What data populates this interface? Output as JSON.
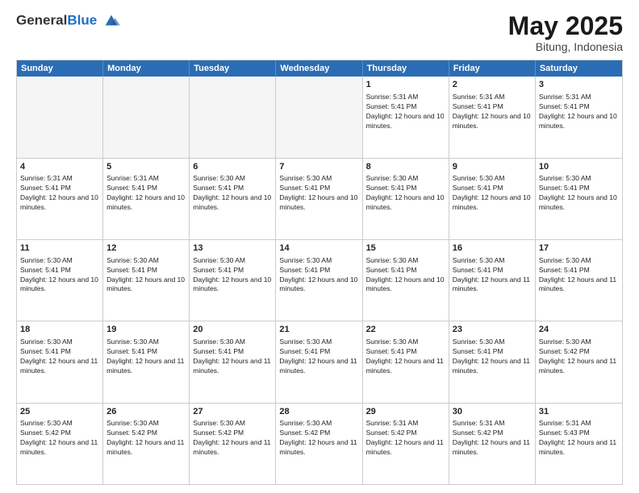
{
  "header": {
    "logo_general": "General",
    "logo_blue": "Blue",
    "title": "May 2025",
    "location": "Bitung, Indonesia"
  },
  "days_of_week": [
    "Sunday",
    "Monday",
    "Tuesday",
    "Wednesday",
    "Thursday",
    "Friday",
    "Saturday"
  ],
  "weeks": [
    [
      {
        "day": "",
        "empty": true
      },
      {
        "day": "",
        "empty": true
      },
      {
        "day": "",
        "empty": true
      },
      {
        "day": "",
        "empty": true
      },
      {
        "day": "1",
        "sunrise": "5:31 AM",
        "sunset": "5:41 PM",
        "daylight": "12 hours and 10 minutes."
      },
      {
        "day": "2",
        "sunrise": "5:31 AM",
        "sunset": "5:41 PM",
        "daylight": "12 hours and 10 minutes."
      },
      {
        "day": "3",
        "sunrise": "5:31 AM",
        "sunset": "5:41 PM",
        "daylight": "12 hours and 10 minutes."
      }
    ],
    [
      {
        "day": "4",
        "sunrise": "5:31 AM",
        "sunset": "5:41 PM",
        "daylight": "12 hours and 10 minutes."
      },
      {
        "day": "5",
        "sunrise": "5:31 AM",
        "sunset": "5:41 PM",
        "daylight": "12 hours and 10 minutes."
      },
      {
        "day": "6",
        "sunrise": "5:30 AM",
        "sunset": "5:41 PM",
        "daylight": "12 hours and 10 minutes."
      },
      {
        "day": "7",
        "sunrise": "5:30 AM",
        "sunset": "5:41 PM",
        "daylight": "12 hours and 10 minutes."
      },
      {
        "day": "8",
        "sunrise": "5:30 AM",
        "sunset": "5:41 PM",
        "daylight": "12 hours and 10 minutes."
      },
      {
        "day": "9",
        "sunrise": "5:30 AM",
        "sunset": "5:41 PM",
        "daylight": "12 hours and 10 minutes."
      },
      {
        "day": "10",
        "sunrise": "5:30 AM",
        "sunset": "5:41 PM",
        "daylight": "12 hours and 10 minutes."
      }
    ],
    [
      {
        "day": "11",
        "sunrise": "5:30 AM",
        "sunset": "5:41 PM",
        "daylight": "12 hours and 10 minutes."
      },
      {
        "day": "12",
        "sunrise": "5:30 AM",
        "sunset": "5:41 PM",
        "daylight": "12 hours and 10 minutes."
      },
      {
        "day": "13",
        "sunrise": "5:30 AM",
        "sunset": "5:41 PM",
        "daylight": "12 hours and 10 minutes."
      },
      {
        "day": "14",
        "sunrise": "5:30 AM",
        "sunset": "5:41 PM",
        "daylight": "12 hours and 10 minutes."
      },
      {
        "day": "15",
        "sunrise": "5:30 AM",
        "sunset": "5:41 PM",
        "daylight": "12 hours and 10 minutes."
      },
      {
        "day": "16",
        "sunrise": "5:30 AM",
        "sunset": "5:41 PM",
        "daylight": "12 hours and 11 minutes."
      },
      {
        "day": "17",
        "sunrise": "5:30 AM",
        "sunset": "5:41 PM",
        "daylight": "12 hours and 11 minutes."
      }
    ],
    [
      {
        "day": "18",
        "sunrise": "5:30 AM",
        "sunset": "5:41 PM",
        "daylight": "12 hours and 11 minutes."
      },
      {
        "day": "19",
        "sunrise": "5:30 AM",
        "sunset": "5:41 PM",
        "daylight": "12 hours and 11 minutes."
      },
      {
        "day": "20",
        "sunrise": "5:30 AM",
        "sunset": "5:41 PM",
        "daylight": "12 hours and 11 minutes."
      },
      {
        "day": "21",
        "sunrise": "5:30 AM",
        "sunset": "5:41 PM",
        "daylight": "12 hours and 11 minutes."
      },
      {
        "day": "22",
        "sunrise": "5:30 AM",
        "sunset": "5:41 PM",
        "daylight": "12 hours and 11 minutes."
      },
      {
        "day": "23",
        "sunrise": "5:30 AM",
        "sunset": "5:41 PM",
        "daylight": "12 hours and 11 minutes."
      },
      {
        "day": "24",
        "sunrise": "5:30 AM",
        "sunset": "5:42 PM",
        "daylight": "12 hours and 11 minutes."
      }
    ],
    [
      {
        "day": "25",
        "sunrise": "5:30 AM",
        "sunset": "5:42 PM",
        "daylight": "12 hours and 11 minutes."
      },
      {
        "day": "26",
        "sunrise": "5:30 AM",
        "sunset": "5:42 PM",
        "daylight": "12 hours and 11 minutes."
      },
      {
        "day": "27",
        "sunrise": "5:30 AM",
        "sunset": "5:42 PM",
        "daylight": "12 hours and 11 minutes."
      },
      {
        "day": "28",
        "sunrise": "5:30 AM",
        "sunset": "5:42 PM",
        "daylight": "12 hours and 11 minutes."
      },
      {
        "day": "29",
        "sunrise": "5:31 AM",
        "sunset": "5:42 PM",
        "daylight": "12 hours and 11 minutes."
      },
      {
        "day": "30",
        "sunrise": "5:31 AM",
        "sunset": "5:42 PM",
        "daylight": "12 hours and 11 minutes."
      },
      {
        "day": "31",
        "sunrise": "5:31 AM",
        "sunset": "5:43 PM",
        "daylight": "12 hours and 11 minutes."
      }
    ]
  ],
  "labels": {
    "sunrise": "Sunrise:",
    "sunset": "Sunset:",
    "daylight": "Daylight:"
  }
}
